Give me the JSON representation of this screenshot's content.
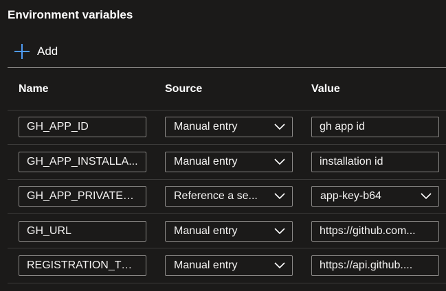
{
  "section": {
    "title": "Environment variables"
  },
  "toolbar": {
    "add_label": "Add",
    "add_icon": "plus-icon"
  },
  "colors": {
    "accent": "#4f9bf5",
    "background": "#1b1a19",
    "border": "#8a8886"
  },
  "table": {
    "columns": {
      "name": "Name",
      "source": "Source",
      "value": "Value"
    },
    "rows": [
      {
        "name": "GH_APP_ID",
        "source": "Manual entry",
        "value": "gh app id"
      },
      {
        "name": "GH_APP_INSTALLA...",
        "source": "Manual entry",
        "value": "installation id"
      },
      {
        "name": "GH_APP_PRIVATE_...",
        "source": "Reference a se...",
        "value": "app-key-b64"
      },
      {
        "name": "GH_URL",
        "source": "Manual entry",
        "value": "https://github.com..."
      },
      {
        "name": "REGISTRATION_TO...",
        "source": "Manual entry",
        "value": "https://api.github...."
      }
    ]
  }
}
